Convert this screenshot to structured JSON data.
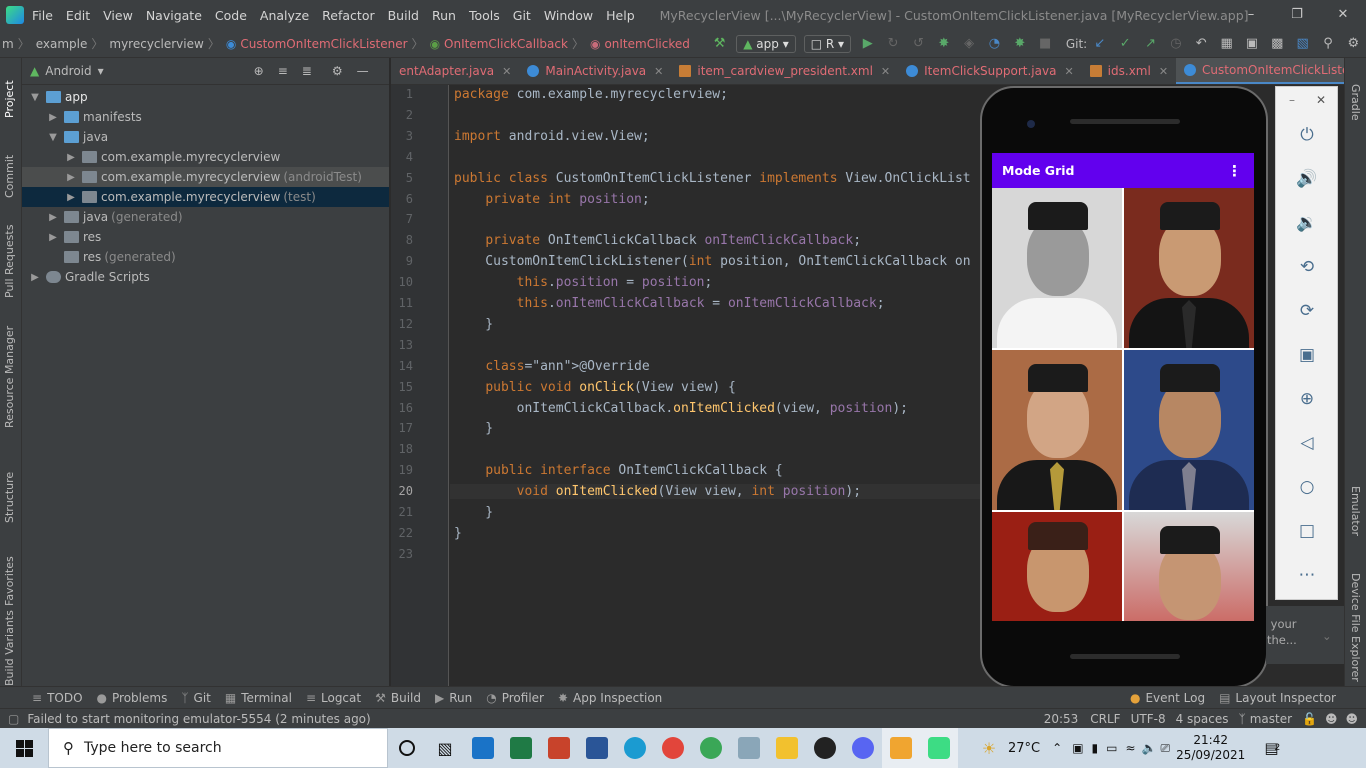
{
  "menu": [
    "File",
    "Edit",
    "View",
    "Navigate",
    "Code",
    "Analyze",
    "Refactor",
    "Build",
    "Run",
    "Tools",
    "Git",
    "Window",
    "Help"
  ],
  "window_title": "MyRecyclerView [...\\MyRecyclerView] - CustomOnItemClickListener.java [MyRecyclerView.app]",
  "breadcrumbs": [
    "m",
    "example",
    "myrecyclerview",
    "CustomOnItemClickListener",
    "OnItemClickCallback",
    "onItemClicked"
  ],
  "run_config": "app",
  "device_combo": "R",
  "git_label": "Git:",
  "project_panel": {
    "title": "Android",
    "tree": [
      {
        "label": "app",
        "indent": 0,
        "icon": "folder-blue",
        "expanded": true
      },
      {
        "label": "manifests",
        "indent": 1,
        "icon": "folder-blue",
        "expanded": false
      },
      {
        "label": "java",
        "indent": 1,
        "icon": "folder-blue",
        "expanded": true
      },
      {
        "label": "com.example.myrecyclerview",
        "suffix": "",
        "indent": 2,
        "icon": "package"
      },
      {
        "label": "com.example.myrecyclerview",
        "suffix": "(androidTest)",
        "indent": 2,
        "icon": "package"
      },
      {
        "label": "com.example.myrecyclerview",
        "suffix": "(test)",
        "indent": 2,
        "icon": "package"
      },
      {
        "label": "java",
        "suffix": "(generated)",
        "indent": 1,
        "icon": "folder-gray"
      },
      {
        "label": "res",
        "indent": 1,
        "icon": "folder-res"
      },
      {
        "label": "res",
        "suffix": "(generated)",
        "indent": 1,
        "icon": "folder-res"
      },
      {
        "label": "Gradle Scripts",
        "indent": 0,
        "icon": "gradle"
      }
    ]
  },
  "editor_tabs": [
    {
      "label": "entAdapter.java",
      "icon": "java-class"
    },
    {
      "label": "MainActivity.java",
      "icon": "java-class"
    },
    {
      "label": "item_cardview_president.xml",
      "icon": "xml-file"
    },
    {
      "label": "ItemClickSupport.java",
      "icon": "java-class"
    },
    {
      "label": "ids.xml",
      "icon": "xml-file"
    },
    {
      "label": "CustomOnItemClickListener.java",
      "icon": "java-class",
      "active": true
    }
  ],
  "code_lines": [
    "package com.example.myrecyclerview;",
    "",
    "import android.view.View;",
    "",
    "public class CustomOnItemClickListener implements View.OnClickList",
    "    private int position;",
    "",
    "    private OnItemClickCallback onItemClickCallback;",
    "    CustomOnItemClickListener(int position, OnItemClickCallback on",
    "        this.position = position;",
    "        this.onItemClickCallback = onItemClickCallback;",
    "    }",
    "",
    "    @Override",
    "    public void onClick(View view) {",
    "        onItemClickCallback.onItemClicked(view, position);",
    "    }",
    "",
    "    public interface OnItemClickCallback {",
    "        void onItemClicked(View view, int position);",
    "    }",
    "}",
    ""
  ],
  "emulator": {
    "app_title": "Mode Grid",
    "controls": [
      "power-icon",
      "volume-up-icon",
      "volume-down-icon",
      "rotate-left-icon",
      "rotate-right-icon",
      "camera-icon",
      "zoom-icon",
      "back-icon",
      "home-icon",
      "overview-icon",
      "more-icon"
    ],
    "tip": "...n your the..."
  },
  "tool_windows": [
    "TODO",
    "Problems",
    "Git",
    "Terminal",
    "Logcat",
    "Build",
    "Run",
    "Profiler",
    "App Inspection"
  ],
  "tool_windows_right": [
    "Event Log",
    "Layout Inspector"
  ],
  "left_tabs": [
    "Project",
    "Commit",
    "Pull Requests",
    "Resource Manager",
    "Structure",
    "Favorites",
    "Build Variants"
  ],
  "right_tabs": [
    "Gradle",
    "Emulator",
    "Device File Explorer"
  ],
  "status": {
    "message": "Failed to start monitoring emulator-5554 (2 minutes ago)",
    "position": "20:53",
    "line_sep": "CRLF",
    "encoding": "UTF-8",
    "indent": "4 spaces",
    "branch": "master"
  },
  "taskbar": {
    "search_placeholder": "Type here to search",
    "temperature": "27°C",
    "time": "21:42",
    "date": "25/09/2021",
    "notifications": "2"
  }
}
